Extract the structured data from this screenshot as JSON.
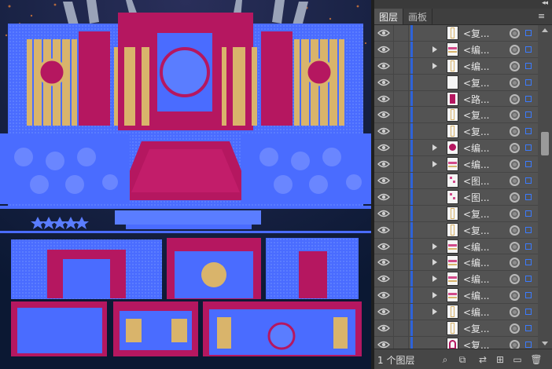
{
  "panel": {
    "collapse_glyph": "◂◂",
    "menu_icon": "panel-menu-icon",
    "tabs": [
      {
        "label": "图层",
        "active": true
      },
      {
        "label": "画板",
        "active": false
      }
    ],
    "layers": [
      {
        "name": "<复...",
        "expand": false,
        "thumb": "tall"
      },
      {
        "name": "<编...",
        "expand": true,
        "thumb": "pattern"
      },
      {
        "name": "<编...",
        "expand": true,
        "thumb": "tall"
      },
      {
        "name": "<复...",
        "expand": false,
        "thumb": "blank"
      },
      {
        "name": "<路...",
        "expand": false,
        "thumb": "magenta"
      },
      {
        "name": "<复...",
        "expand": false,
        "thumb": "tall"
      },
      {
        "name": "<复...",
        "expand": false,
        "thumb": "tall"
      },
      {
        "name": "<编...",
        "expand": true,
        "thumb": "round"
      },
      {
        "name": "<编...",
        "expand": true,
        "thumb": "pattern"
      },
      {
        "name": "<图...",
        "expand": false,
        "thumb": "sparse"
      },
      {
        "name": "<图...",
        "expand": false,
        "thumb": "sparse"
      },
      {
        "name": "<复...",
        "expand": false,
        "thumb": "tall"
      },
      {
        "name": "<复...",
        "expand": false,
        "thumb": "tall"
      },
      {
        "name": "<编...",
        "expand": true,
        "thumb": "pattern"
      },
      {
        "name": "<编...",
        "expand": true,
        "thumb": "pattern"
      },
      {
        "name": "<编...",
        "expand": true,
        "thumb": "pattern"
      },
      {
        "name": "<编...",
        "expand": true,
        "thumb": "pattern"
      },
      {
        "name": "<编...",
        "expand": true,
        "thumb": "tall"
      },
      {
        "name": "<复...",
        "expand": false,
        "thumb": "tall"
      },
      {
        "name": "<复...",
        "expand": false,
        "thumb": "arch"
      }
    ],
    "footer": {
      "count": "1 个图层",
      "icons": [
        "locate-object-icon",
        "collect-export-icon",
        "make-clip-mask-icon",
        "new-sublayer-icon",
        "new-layer-icon",
        "delete-layer-icon"
      ]
    }
  },
  "colors": {
    "canvas_bg": "#0b1833",
    "magenta": "#b51760",
    "blue": "#4a6cff",
    "gold": "#d9b46b",
    "panel_bg": "#535353",
    "selection": "#2e63d9"
  }
}
